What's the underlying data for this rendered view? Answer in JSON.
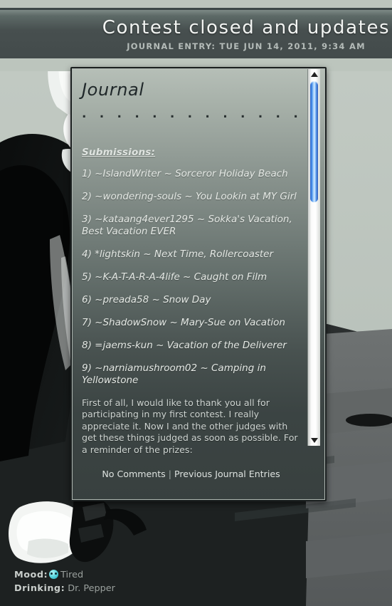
{
  "header": {
    "title": "Contest closed and updates",
    "subtitle": "JOURNAL ENTRY: TUE JUN 14, 2011, 9:34 AM"
  },
  "journal": {
    "title": "Journal",
    "divider": ". . . . . . . . . . . . . . . . . . . . . . . . .",
    "submissions_heading": "Submissions:",
    "submissions": [
      "1) ~IslandWriter ~ Sorceror Holiday Beach",
      "2) ~wondering-souls ~ You Lookin at MY Girl",
      "3) ~kataang4ever1295 ~ Sokka's Vacation, Best Vacation EVER",
      "4) *lightskin ~ Next Time, Rollercoaster",
      "5) ~K-A-T-A-R-A-4life ~ Caught on Film",
      "6) ~preada58 ~ Snow Day",
      "7) ~ShadowSnow ~ Mary-Sue on Vacation",
      "8) =jaems-kun ~ Vacation of the Deliverer",
      "9) ~narniamushroom02 ~ Camping in Yellowstone"
    ],
    "body": "First of all, I would like to thank you all for participating in my first contest. I really appreciate it. Now I and the other judges with get these things judged as soon as possible. For a reminder of the prizes:"
  },
  "footer": {
    "comments_link": "No Comments",
    "separator": "|",
    "previous_link": "Previous Journal Entries"
  },
  "meta": {
    "mood_label": "Mood:",
    "mood_value": "Tired",
    "mood_icon": "emoticon-face-icon",
    "drinking_label": "Drinking:",
    "drinking_value": "Dr. Pepper"
  },
  "scrollbar": {
    "up_icon": "triangle-up-icon",
    "down_icon": "triangle-down-icon"
  },
  "colors": {
    "header_bg": "#434b4b",
    "sage": "#bcc5bd",
    "panel_top": "#bcc5bd",
    "panel_bottom": "#3a4241",
    "scroll_thumb": "#3f86e8",
    "mood_icon": "#5fd8e0",
    "text_light": "#e4e8e4"
  }
}
